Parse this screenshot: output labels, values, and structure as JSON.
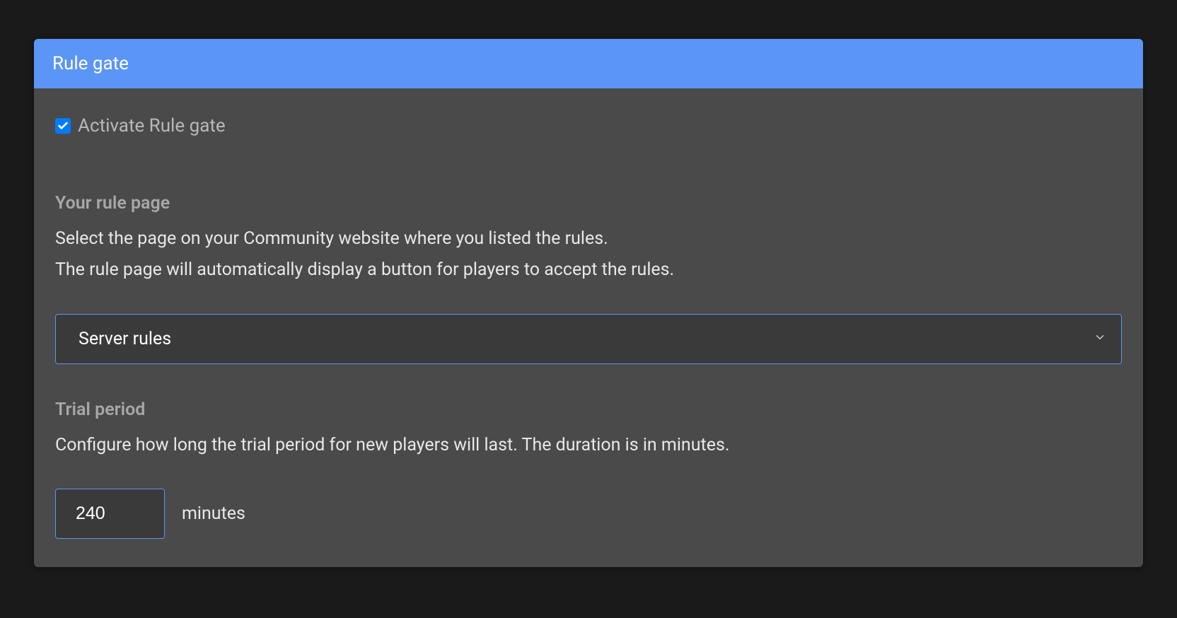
{
  "card": {
    "title": "Rule gate",
    "activate_label": "Activate Rule gate",
    "activate_checked": true,
    "rule_page": {
      "title": "Your rule page",
      "desc_line1": "Select the page on your Community website where you listed the rules.",
      "desc_line2": "The rule page will automatically display a button for players to accept the rules.",
      "selected_value": "Server rules"
    },
    "trial_period": {
      "title": "Trial period",
      "desc": "Configure how long the trial period for new players will last. The duration is in minutes.",
      "value": "240",
      "suffix": "minutes"
    }
  }
}
